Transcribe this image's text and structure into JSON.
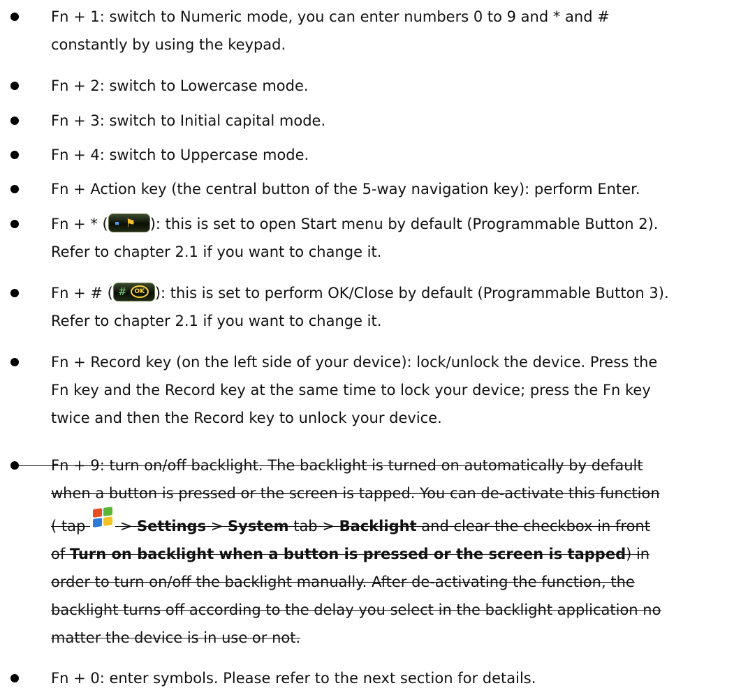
{
  "items": [
    {
      "lines": [
        "Fn + 1: switch to Numeric mode, you can enter numbers 0 to 9 and * and #",
        "constantly by using the keypad."
      ]
    },
    {
      "lines": [
        "Fn + 2: switch to Lowercase mode."
      ]
    },
    {
      "lines": [
        "Fn + 3: switch to Initial capital mode."
      ]
    },
    {
      "lines": [
        "Fn + 4: switch to Uppercase mode."
      ]
    },
    {
      "lines": [
        "Fn + Action key (the central button of the 5-way navigation key): perform Enter."
      ]
    },
    {
      "pre": "Fn + * (",
      "post": "): this is set to open Start menu by default (Programmable Button 2).",
      "line2": "Refer to chapter 2.1 if you want to change it."
    },
    {
      "pre": "Fn + # (",
      "post": "): this is set to perform OK/Close by default (Programmable Button 3).",
      "line2": "Refer to chapter 2.1 if you want to change it."
    },
    {
      "lines": [
        "Fn + Record key (on the left side of your device): lock/unlock the device. Press the",
        "Fn key and the Record key at the same time to lock your device; press the Fn key",
        "twice and then the Record key to unlock your device."
      ]
    },
    {
      "l1": "Fn + 9: turn on/off backlight. The backlight is turned on automatically by default",
      "l2": "when a button is pressed or the screen is tapped. You can de-activate this function",
      "l3a": "( tap",
      "l3b": "> ",
      "l3c": "Settings",
      "l3d": " > ",
      "l3e": "System",
      "l3f": " tab > ",
      "l3g": "Backlight",
      "l3h": " and clear the checkbox in front",
      "l4a": "of ",
      "l4b": "Turn on backlight when a button is pressed or the screen is tapped",
      "l4c": ") in",
      "l5": "order to turn on/off the backlight manually. After de-activating the function, the",
      "l6": "backlight turns off according to the delay you select in the backlight application no",
      "l7": "matter the device is in use or not."
    },
    {
      "lines": [
        "Fn + 0: enter symbols. Please refer to the next section for details."
      ]
    }
  ],
  "icons": {
    "start_button": "windows-flag-button",
    "ok_button": "hash-ok-button",
    "start_logo": "windows-logo"
  }
}
